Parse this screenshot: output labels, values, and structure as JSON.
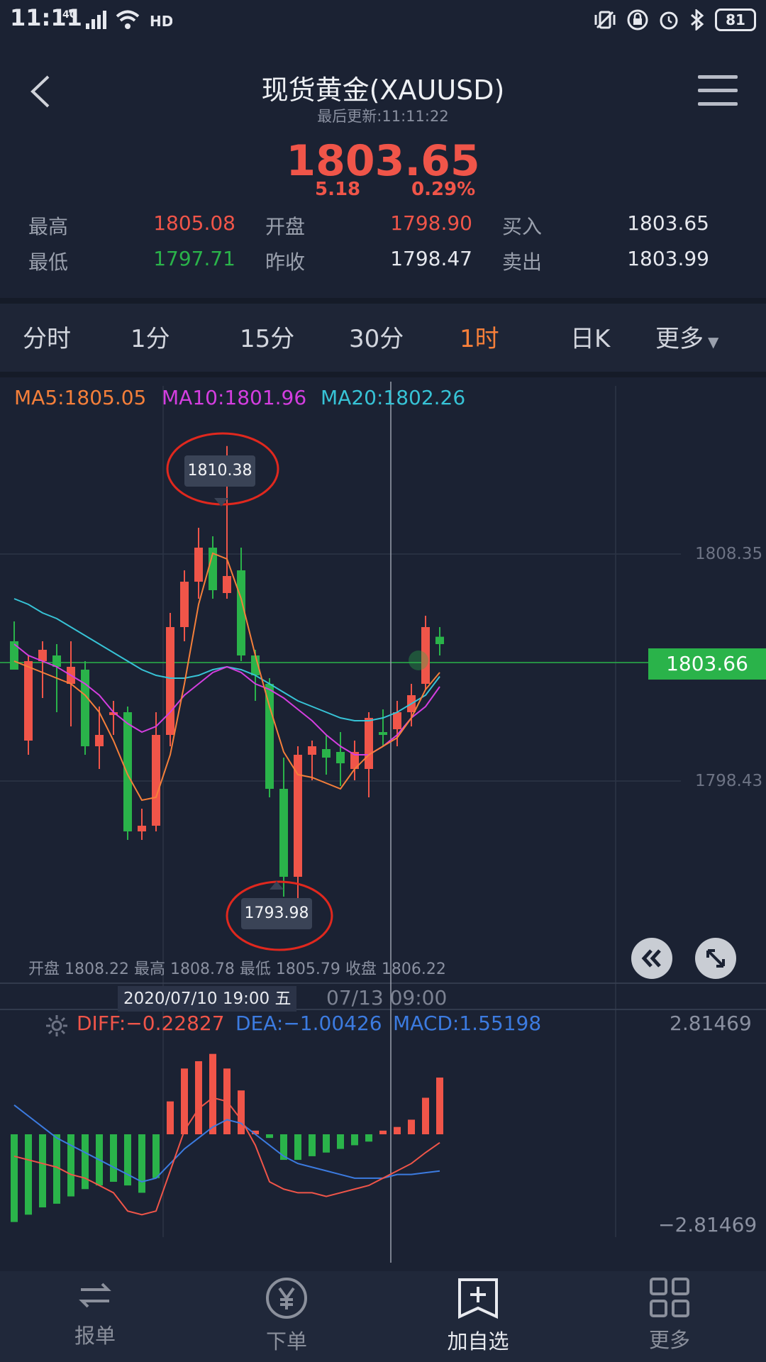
{
  "status": {
    "time": "11:11",
    "network": "4G",
    "battery": "81"
  },
  "header": {
    "title": "现货黄金(XAUUSD)",
    "updated": "最后更新:11:11:22",
    "price": "1803.65",
    "change": "5.18",
    "change_pct": "0.29%",
    "stats": {
      "high_label": "最高",
      "high": "1805.08",
      "low_label": "最低",
      "low": "1797.71",
      "open_label": "开盘",
      "open": "1798.90",
      "prev_close_label": "昨收",
      "prev_close": "1798.47",
      "buy_label": "买入",
      "buy": "1803.65",
      "sell_label": "卖出",
      "sell": "1803.99"
    }
  },
  "tabs": [
    "分时",
    "1分",
    "15分",
    "30分",
    "1时",
    "日K",
    "更多"
  ],
  "active_tab": "1时",
  "chart_overlay": {
    "ma5": "MA5:1805.05",
    "ma10": "MA10:1801.96",
    "ma20": "MA20:1802.26",
    "y_top": "1808.35",
    "y_bottom": "1798.43",
    "current_price": "1803.66",
    "max_callout": "1810.38",
    "min_callout": "1793.98",
    "ohlc": "开盘 1808.22 最高 1808.78 最低 1805.79 收盘 1806.22",
    "cross_date": "2020/07/10 19:00 五",
    "date_right": "07/13 09:00",
    "diff": "DIFF:−0.22827",
    "dea": "DEA:−1.00426",
    "macd": "MACD:1.55198",
    "macd_top": "2.81469",
    "macd_bottom": "−2.81469"
  },
  "colors": {
    "up": "#f05549",
    "down": "#2ab34a",
    "ma5": "#f57f3a",
    "ma10": "#d43ee0",
    "ma20": "#37c3d6",
    "dea": "#3c7be0"
  },
  "nav": [
    {
      "label": "报单",
      "icon": "swap-icon"
    },
    {
      "label": "下单",
      "icon": "yen-icon"
    },
    {
      "label": "加自选",
      "icon": "add-favorite-icon"
    },
    {
      "label": "更多",
      "icon": "grid-icon"
    }
  ],
  "chart_data": {
    "type": "candlestick",
    "ylim": [
      1791.5,
      1812.5
    ],
    "candles": [
      [
        1803.5,
        1804.2,
        1802.8,
        1802.5,
        "down"
      ],
      [
        1800.0,
        1803.0,
        1799.5,
        1802.8,
        "up"
      ],
      [
        1803.2,
        1803.5,
        1801.5,
        1802.8,
        "up"
      ],
      [
        1803.0,
        1803.4,
        1801.0,
        1802.6,
        "down"
      ],
      [
        1802.0,
        1803.5,
        1800.5,
        1802.6,
        "up"
      ],
      [
        1802.5,
        1802.8,
        1799.5,
        1799.8,
        "down"
      ],
      [
        1799.8,
        1801.2,
        1799.0,
        1800.2,
        "up"
      ],
      [
        1801.0,
        1801.4,
        1800.2,
        1800.9,
        "up"
      ],
      [
        1801.0,
        1801.2,
        1796.5,
        1796.8,
        "down"
      ],
      [
        1796.8,
        1797.6,
        1796.5,
        1797.0,
        "up"
      ],
      [
        1797.0,
        1801.0,
        1796.8,
        1800.2,
        "up"
      ],
      [
        1800.2,
        1804.5,
        1799.8,
        1804.0,
        "up"
      ],
      [
        1804.0,
        1806.0,
        1803.5,
        1805.6,
        "up"
      ],
      [
        1805.6,
        1807.5,
        1805.0,
        1806.8,
        "up"
      ],
      [
        1806.8,
        1807.2,
        1805.0,
        1805.3,
        "down"
      ],
      [
        1805.2,
        1810.38,
        1805.0,
        1805.8,
        "up"
      ],
      [
        1806.0,
        1806.8,
        1802.8,
        1803.0,
        "down"
      ],
      [
        1803.0,
        1803.2,
        1801.4,
        1802.3,
        "down"
      ],
      [
        1802.0,
        1802.2,
        1798.0,
        1798.3,
        "down"
      ],
      [
        1798.3,
        1799.4,
        1794.5,
        1795.2,
        "down"
      ],
      [
        1795.2,
        1799.8,
        1793.98,
        1799.5,
        "up"
      ],
      [
        1799.5,
        1800.0,
        1798.6,
        1799.8,
        "up"
      ],
      [
        1799.7,
        1800.2,
        1798.8,
        1799.4,
        "down"
      ],
      [
        1799.2,
        1800.3,
        1798.4,
        1799.6,
        "down"
      ],
      [
        1799.6,
        1800.0,
        1798.6,
        1799.0,
        "up"
      ],
      [
        1799.0,
        1801.0,
        1798.0,
        1800.8,
        "up"
      ],
      [
        1800.2,
        1801.1,
        1799.8,
        1800.3,
        "down"
      ],
      [
        1800.4,
        1801.4,
        1799.8,
        1801.0,
        "up"
      ],
      [
        1801.0,
        1802.0,
        1800.5,
        1801.6,
        "up"
      ],
      [
        1802.0,
        1804.4,
        1801.8,
        1804.0,
        "up"
      ],
      [
        1803.4,
        1804.0,
        1803.0,
        1803.66,
        "down"
      ]
    ],
    "ma5": [
      1802.8,
      1802.6,
      1802.4,
      1802.2,
      1802.0,
      1801.6,
      1801.0,
      1800.0,
      1798.8,
      1797.9,
      1798.0,
      1799.5,
      1802.0,
      1804.8,
      1806.6,
      1806.4,
      1805.0,
      1803.0,
      1801.2,
      1799.6,
      1798.8,
      1798.7,
      1798.5,
      1798.3,
      1799.0,
      1799.5,
      1799.8,
      1800.1,
      1800.8,
      1801.8,
      1802.4
    ],
    "ma10": [
      1803.4,
      1803.0,
      1802.8,
      1802.6,
      1802.3,
      1802.0,
      1801.6,
      1801.0,
      1800.6,
      1800.3,
      1800.5,
      1801.0,
      1801.6,
      1802.0,
      1802.4,
      1802.6,
      1802.4,
      1802.0,
      1801.8,
      1801.5,
      1801.1,
      1800.7,
      1800.2,
      1799.8,
      1799.5,
      1799.5,
      1799.8,
      1800.2,
      1800.8,
      1801.2,
      1801.9
    ],
    "ma20": [
      1805.0,
      1804.8,
      1804.5,
      1804.3,
      1804.0,
      1803.7,
      1803.4,
      1803.1,
      1802.8,
      1802.5,
      1802.3,
      1802.2,
      1802.2,
      1802.3,
      1802.5,
      1802.6,
      1802.5,
      1802.3,
      1802.0,
      1801.7,
      1801.4,
      1801.2,
      1801.0,
      1800.8,
      1800.7,
      1800.7,
      1800.8,
      1801.0,
      1801.3,
      1801.6,
      1802.26
    ]
  },
  "macd_data": {
    "ylim": [
      -2.81469,
      2.81469
    ],
    "hist": [
      -2.4,
      -2.2,
      -2.0,
      -1.9,
      -1.7,
      -1.5,
      -1.4,
      -1.3,
      -1.4,
      -1.6,
      -1.2,
      0.9,
      1.8,
      2.0,
      2.2,
      1.8,
      1.2,
      0.1,
      -0.1,
      -0.7,
      -0.7,
      -0.6,
      -0.5,
      -0.4,
      -0.3,
      -0.2,
      0.1,
      0.2,
      0.4,
      1.0,
      1.55198
    ],
    "diff": [
      -0.6,
      -0.7,
      -0.8,
      -0.9,
      -1.1,
      -1.2,
      -1.4,
      -1.6,
      -2.1,
      -2.2,
      -2.1,
      -1.0,
      0.1,
      0.7,
      1.0,
      0.9,
      0.4,
      -0.3,
      -1.3,
      -1.5,
      -1.6,
      -1.6,
      -1.7,
      -1.6,
      -1.5,
      -1.4,
      -1.2,
      -1.0,
      -0.8,
      -0.5,
      -0.22827
    ],
    "dea": [
      0.8,
      0.5,
      0.2,
      -0.1,
      -0.3,
      -0.5,
      -0.7,
      -0.9,
      -1.1,
      -1.3,
      -1.2,
      -0.8,
      -0.4,
      -0.1,
      0.2,
      0.4,
      0.3,
      0.0,
      -0.3,
      -0.6,
      -0.8,
      -0.9,
      -1.0,
      -1.1,
      -1.2,
      -1.2,
      -1.2,
      -1.1,
      -1.1,
      -1.05,
      -1.00426
    ]
  }
}
